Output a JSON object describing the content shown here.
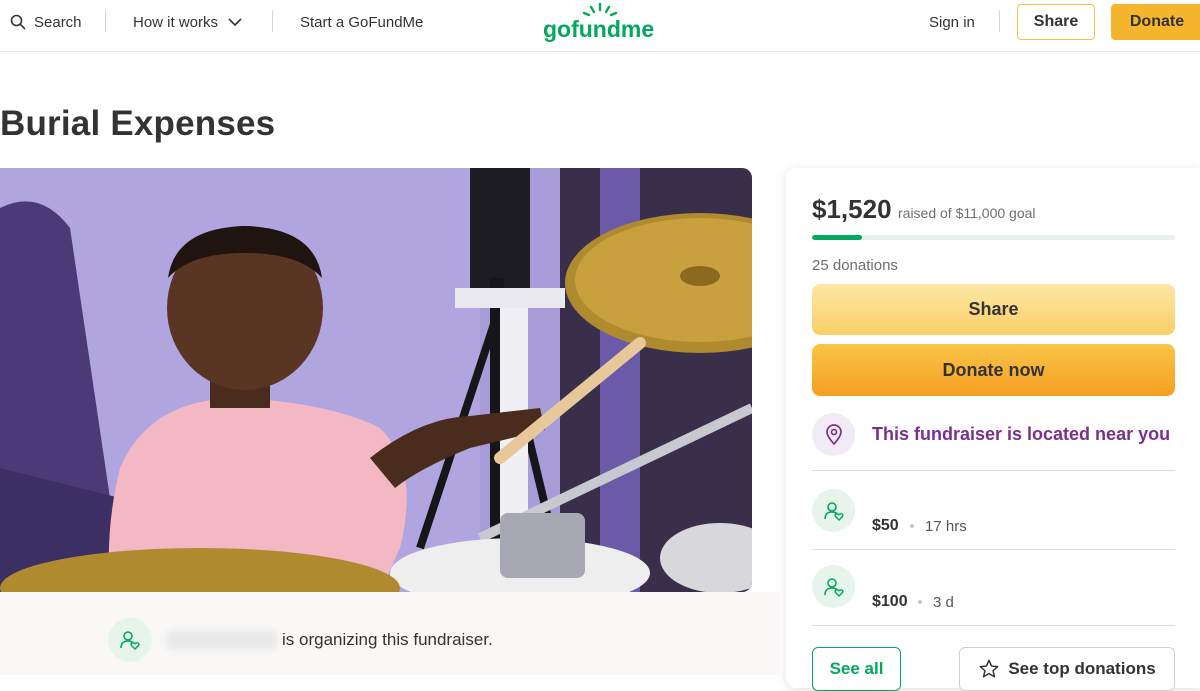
{
  "header": {
    "search_label": "Search",
    "how_it_works_label": "How it works",
    "start_label": "Start a GoFundMe",
    "logo_text": "gofundme",
    "signin_label": "Sign in",
    "share_label": "Share",
    "donate_label": "Donate"
  },
  "campaign": {
    "title": "Burial Expenses",
    "organizer_text": "is organizing this fundraiser."
  },
  "sidebar": {
    "amount_raised": "$1,520",
    "goal_text": "raised of $11,000 goal",
    "progress_fraction": 0.138,
    "donation_count": "25 donations",
    "share_button": "Share",
    "donate_button": "Donate now",
    "location_text": "This fundraiser is located near you",
    "donations": [
      {
        "amount": "$50",
        "time": "17 hrs"
      },
      {
        "amount": "$100",
        "time": "3 d"
      }
    ],
    "see_all_button": "See all",
    "top_donations_button": "See top donations"
  },
  "colors": {
    "brand_green": "#02a95c",
    "donate_orange": "#f59e22",
    "location_purple": "#7a2f8e"
  }
}
